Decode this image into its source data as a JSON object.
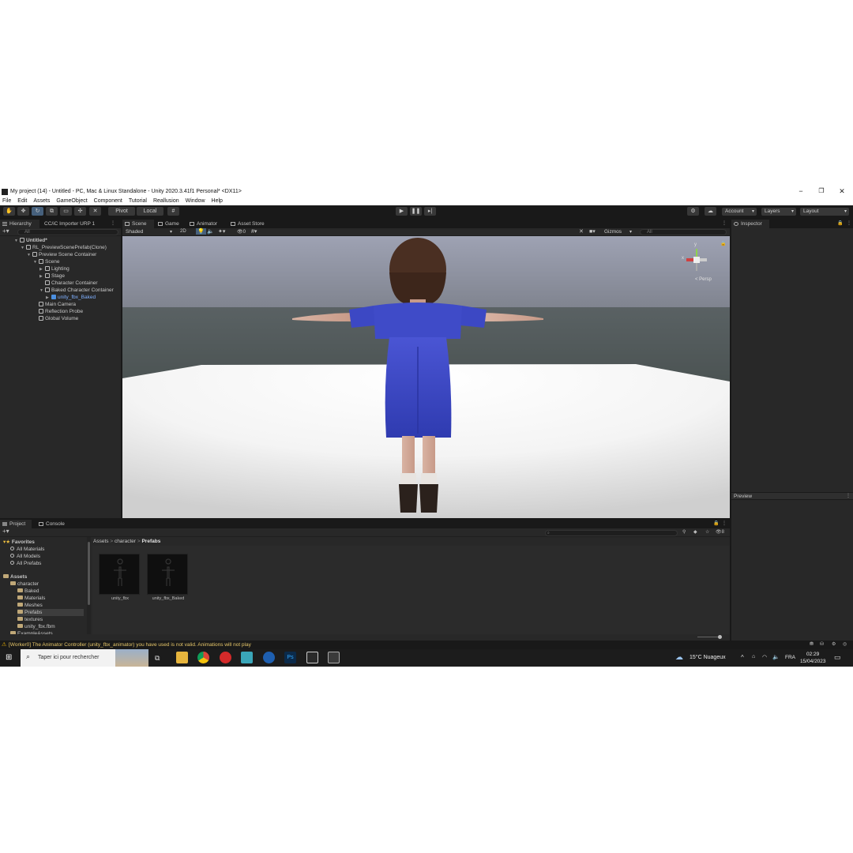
{
  "window": {
    "title": "My project (14) - Untitled - PC, Mac & Linux Standalone - Unity 2020.3.41f1 Personal* <DX11>",
    "minimize": "−",
    "maximize": "❐",
    "close": "✕"
  },
  "menu": [
    "File",
    "Edit",
    "Assets",
    "GameObject",
    "Component",
    "Tutorial",
    "Reallusion",
    "Window",
    "Help"
  ],
  "toolbar": {
    "pivot": "Pivot",
    "local": "Local",
    "account": "Account",
    "layers": "Layers",
    "layout": "Layout"
  },
  "hierarchy": {
    "tabs": [
      "Hierarchy",
      "CC/iC Importer URP 1"
    ],
    "search_placeholder": "All",
    "rows": [
      {
        "label": "Untitled*",
        "depth": 0
      },
      {
        "label": "RL_PreviewScenePrefab(Clone)",
        "depth": 1
      },
      {
        "label": "Preview Scene Container",
        "depth": 2
      },
      {
        "label": "Scene",
        "depth": 3
      },
      {
        "label": "Lighting",
        "depth": 4
      },
      {
        "label": "Stage",
        "depth": 4
      },
      {
        "label": "Character Container",
        "depth": 4
      },
      {
        "label": "Baked Character Container",
        "depth": 4
      },
      {
        "label": "unity_fbx_Baked",
        "depth": 5
      },
      {
        "label": "Main Camera",
        "depth": 3
      },
      {
        "label": "Reflection Probe",
        "depth": 3
      },
      {
        "label": "Global Volume",
        "depth": 3
      }
    ]
  },
  "scene": {
    "tabs": [
      "Scene",
      "Game",
      "Animator",
      "Asset Store"
    ],
    "shading": "Shaded",
    "mode_2d": "2D",
    "gizmos": "Gizmos",
    "search_placeholder": "All",
    "persp_label": "< Persp",
    "axis_y": "y",
    "axis_x": "x",
    "light_count": "0"
  },
  "inspector": {
    "tab": "Inspector",
    "preview_label": "Preview"
  },
  "project": {
    "tabs": [
      "Project",
      "Console"
    ],
    "breadcrumb": [
      "Assets",
      "character",
      "Prefabs"
    ],
    "badge": "8",
    "tree": [
      {
        "label": "Favorites",
        "depth": 0,
        "kind": "star"
      },
      {
        "label": "All Materials",
        "depth": 1,
        "kind": "search"
      },
      {
        "label": "All Models",
        "depth": 1,
        "kind": "search"
      },
      {
        "label": "All Prefabs",
        "depth": 1,
        "kind": "search"
      },
      {
        "label": "Assets",
        "depth": 0,
        "kind": "folder"
      },
      {
        "label": "character",
        "depth": 1,
        "kind": "folder"
      },
      {
        "label": "Baked",
        "depth": 2,
        "kind": "folder"
      },
      {
        "label": "Materials",
        "depth": 2,
        "kind": "folder"
      },
      {
        "label": "Meshes",
        "depth": 2,
        "kind": "folder"
      },
      {
        "label": "Prefabs",
        "depth": 2,
        "kind": "folder"
      },
      {
        "label": "textures",
        "depth": 2,
        "kind": "folder"
      },
      {
        "label": "unity_fbx.fbm",
        "depth": 2,
        "kind": "folder"
      },
      {
        "label": "ExampleAssets",
        "depth": 1,
        "kind": "folder"
      }
    ],
    "assets": [
      "unity_fbx",
      "unity_fbx_Baked"
    ]
  },
  "status": {
    "message": "[Worker0] The Animator Controller (unity_fbx_animator) you have used is not valid. Animations will not play"
  },
  "taskbar": {
    "search_placeholder": "Taper ici pour rechercher",
    "weather": "15°C  Nuageux",
    "lang": "FRA",
    "time": "02:29",
    "date": "15/04/2023"
  },
  "colors": {
    "accent_selection": "#2c5d87",
    "active_tool": "#46607c",
    "dress": "#3b49c6",
    "warning": "#f0b400"
  }
}
